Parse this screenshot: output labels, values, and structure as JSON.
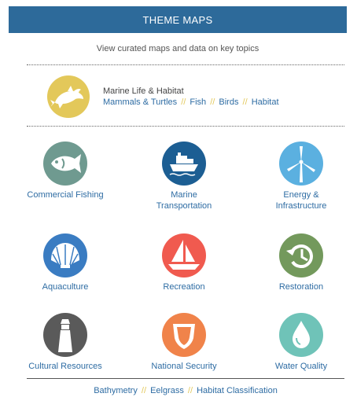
{
  "header": {
    "title": "THEME MAPS"
  },
  "subtitle": "View curated maps and data on key topics",
  "featured": {
    "title": "Marine Life & Habitat",
    "icon": "dolphin-icon",
    "color": "#e3c85a",
    "links": [
      "Mammals & Turtles",
      "Fish",
      "Birds",
      "Habitat"
    ]
  },
  "separator": "//",
  "tiles": [
    {
      "label": "Commercial Fishing",
      "icon": "fish-icon",
      "color": "#6f9a90"
    },
    {
      "label": "Marine\nTransportation",
      "icon": "ship-icon",
      "color": "#1c5e93"
    },
    {
      "label": "Energy &\nInfrastructure",
      "icon": "wind-turbine-icon",
      "color": "#5bb0e0"
    },
    {
      "label": "Aquaculture",
      "icon": "shell-icon",
      "color": "#3a7cc2"
    },
    {
      "label": "Recreation",
      "icon": "sailboat-icon",
      "color": "#f05a4f"
    },
    {
      "label": "Restoration",
      "icon": "restore-icon",
      "color": "#73995c"
    },
    {
      "label": "Cultural Resources",
      "icon": "lighthouse-icon",
      "color": "#5a5a5a"
    },
    {
      "label": "National Security",
      "icon": "shield-icon",
      "color": "#f0834a"
    },
    {
      "label": "Water Quality",
      "icon": "water-drop-icon",
      "color": "#6fc3b8"
    }
  ],
  "footer": {
    "links": [
      "Bathymetry",
      "Eelgrass",
      "Habitat Classification"
    ]
  }
}
